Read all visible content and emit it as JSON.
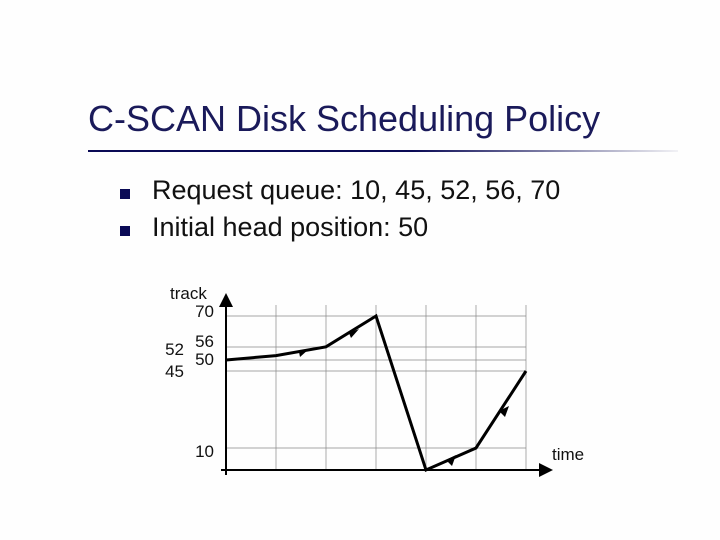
{
  "title": "C-SCAN Disk Scheduling Policy",
  "bullets": [
    "Request queue:  10, 45, 52, 56, 70",
    "Initial head position:  50"
  ],
  "chart_data": {
    "type": "line",
    "title": "",
    "xlabel": "time",
    "ylabel": "track",
    "y_ticks_right": [
      70,
      56,
      50,
      10
    ],
    "y_ticks_left": [
      52,
      45
    ],
    "x": [
      0,
      1,
      2,
      3,
      4,
      5,
      6
    ],
    "values": [
      50,
      52,
      56,
      70,
      0,
      10,
      45
    ],
    "gridlines_y": [
      70,
      56,
      50,
      45,
      10
    ],
    "ylim": [
      0,
      70
    ],
    "xlim": [
      0,
      6
    ]
  }
}
